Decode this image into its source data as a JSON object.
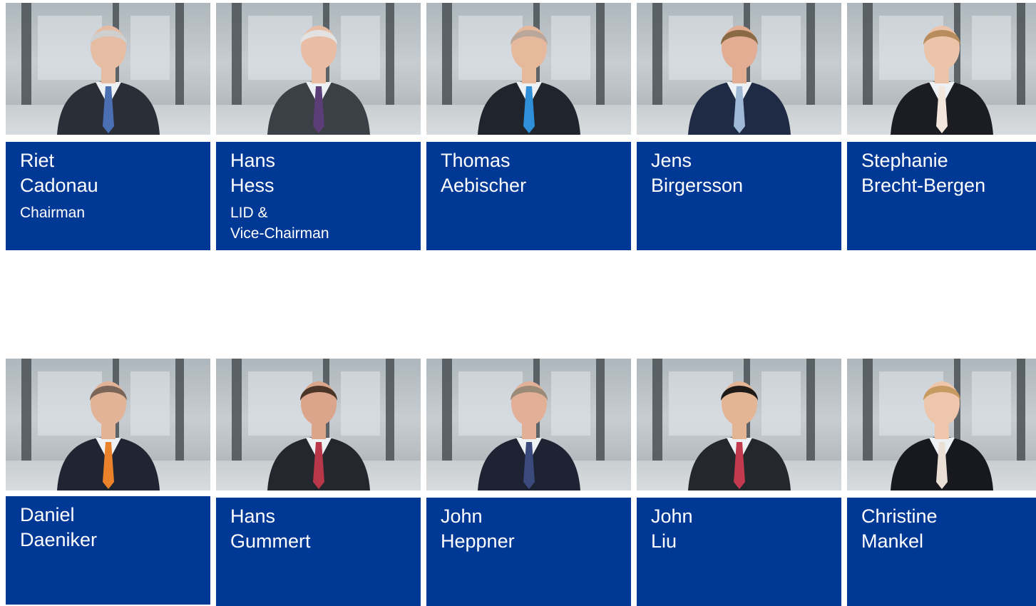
{
  "members": [
    {
      "first": "Riet",
      "last": "Cadonau",
      "role_line1": "Chairman",
      "role_line2": "",
      "tie": "#4a6fb3",
      "suit": "#2a2e36",
      "hair": "#cfcfcf",
      "skin": "#e6bca3"
    },
    {
      "first": "Hans",
      "last": "Hess",
      "role_line1": "LID &",
      "role_line2": "Vice-Chairman",
      "tie": "#5b3d78",
      "suit": "#3b3f46",
      "hair": "#e2e2e2",
      "skin": "#e8bda4"
    },
    {
      "first": "Thomas",
      "last": "Aebischer",
      "role_line1": "",
      "role_line2": "",
      "tie": "#2f8fd8",
      "suit": "#20242c",
      "hair": "#b9a79b",
      "skin": "#e6b99c"
    },
    {
      "first": "Jens",
      "last": "Birgersson",
      "role_line1": "",
      "role_line2": "",
      "tie": "#9fb8d6",
      "suit": "#1f2b45",
      "hair": "#8a6a45",
      "skin": "#e2ad92"
    },
    {
      "first": "Stephanie",
      "last": "Brecht-Bergen",
      "role_line1": "",
      "role_line2": "",
      "tie": "#f3e6dc",
      "suit": "#1b1d23",
      "hair": "#b78d5e",
      "skin": "#ecc4aa"
    },
    {
      "first": "Daniel",
      "last": "Daeniker",
      "role_line1": "",
      "role_line2": "",
      "tie": "#e9822a",
      "suit": "#1f2532",
      "hair": "#7a6558",
      "skin": "#e2b396"
    },
    {
      "first": "Hans",
      "last": "Gummert",
      "role_line1": "",
      "role_line2": "",
      "tie": "#b8384a",
      "suit": "#24272e",
      "hair": "#4b3527",
      "skin": "#dba58b"
    },
    {
      "first": "John",
      "last": "Heppner",
      "role_line1": "",
      "role_line2": "",
      "tie": "#3a4a7c",
      "suit": "#1e2333",
      "hair": "#9b8a77",
      "skin": "#e1b097"
    },
    {
      "first": "John",
      "last": "Liu",
      "role_line1": "",
      "role_line2": "",
      "tie": "#c33a4e",
      "suit": "#24272c",
      "hair": "#1e1a18",
      "skin": "#e3b594"
    },
    {
      "first": "Christine",
      "last": "Mankel",
      "role_line1": "",
      "role_line2": "",
      "tie": "#eadfd4",
      "suit": "#17191e",
      "hair": "#c79a62",
      "skin": "#eec6ab"
    }
  ],
  "colors": {
    "label_background": "#003896",
    "label_text": "#ffffff"
  }
}
